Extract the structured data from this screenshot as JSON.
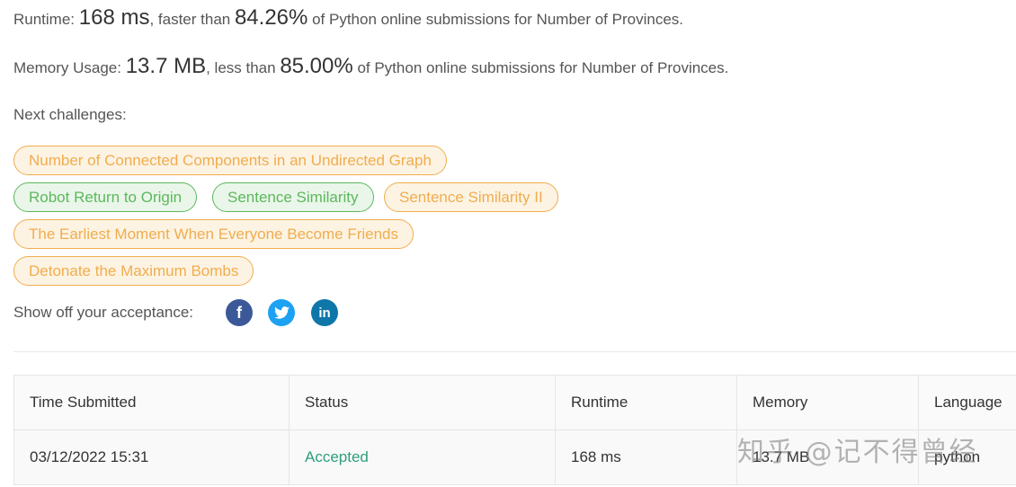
{
  "stats": {
    "runtime_prefix": "Runtime: ",
    "runtime_value": "168 ms",
    "runtime_mid": ", faster than ",
    "runtime_percent": "84.26%",
    "runtime_suffix": " of Python online submissions for Number of Provinces.",
    "memory_prefix": "Memory Usage: ",
    "memory_value": "13.7 MB",
    "memory_mid": ", less than ",
    "memory_percent": "85.00%",
    "memory_suffix": " of Python online submissions for Number of Provinces."
  },
  "next_challenges": {
    "label": "Next challenges:",
    "items": [
      {
        "label": "Number of Connected Components in an Undirected Graph",
        "difficulty": "medium"
      },
      {
        "label": "Robot Return to Origin",
        "difficulty": "easy"
      },
      {
        "label": "Sentence Similarity",
        "difficulty": "easy"
      },
      {
        "label": "Sentence Similarity II",
        "difficulty": "medium"
      },
      {
        "label": "The Earliest Moment When Everyone Become Friends",
        "difficulty": "medium"
      },
      {
        "label": "Detonate the Maximum Bombs",
        "difficulty": "medium"
      }
    ]
  },
  "share": {
    "label": "Show off your acceptance:",
    "icons": [
      "facebook-icon",
      "twitter-icon",
      "linkedin-icon"
    ],
    "facebook_glyph": "f",
    "linkedin_glyph": "in"
  },
  "table": {
    "headers": [
      "Time Submitted",
      "Status",
      "Runtime",
      "Memory",
      "Language"
    ],
    "rows": [
      {
        "time": "03/12/2022 15:31",
        "status": "Accepted",
        "runtime": "168 ms",
        "memory": "13.7 MB",
        "language": "python"
      }
    ]
  },
  "watermark": "知乎 @记不得曾经",
  "colors": {
    "medium": "#f0ad4e",
    "easy": "#5cb85c",
    "accepted": "#2e9e7e",
    "facebook": "#3b5998",
    "twitter": "#1da1f2",
    "linkedin": "#0e76a8"
  }
}
